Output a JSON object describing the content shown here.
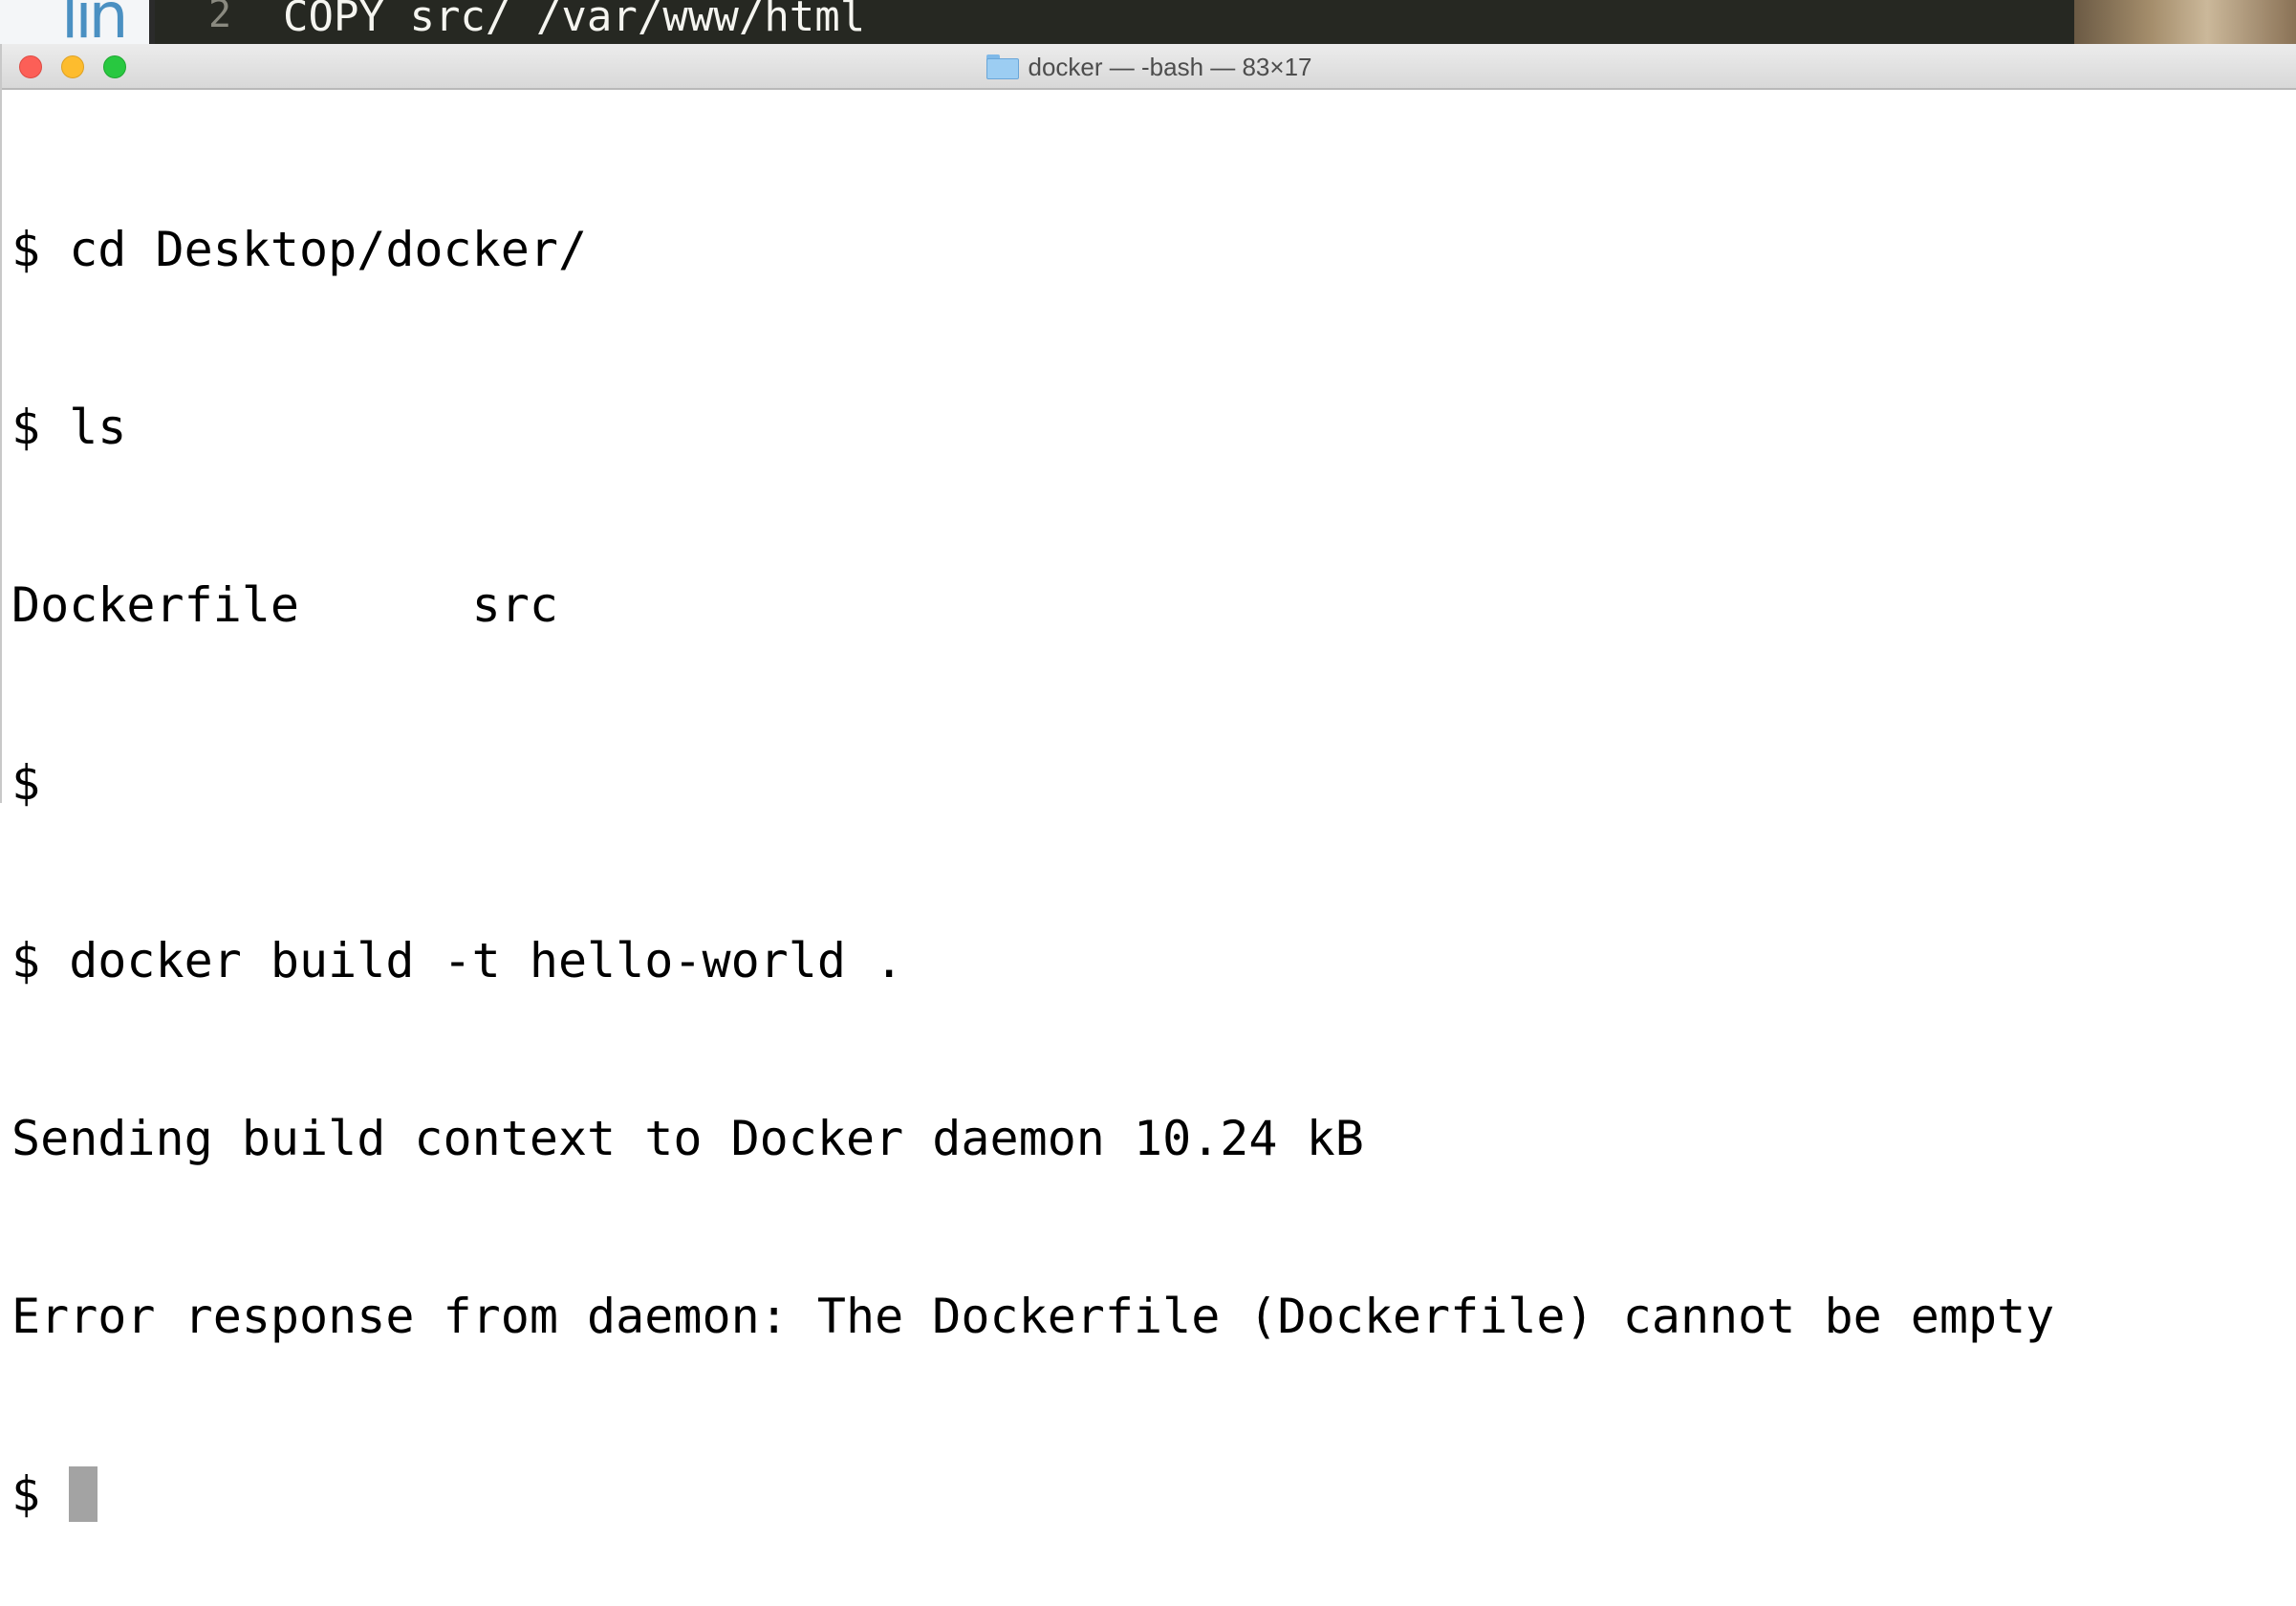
{
  "background_editor": {
    "logo_text": "lin",
    "line_number": "2",
    "line_text": "COPY src/ /var/www/html"
  },
  "window": {
    "title": "docker — -bash — 83×17",
    "title_icon": "folder-icon",
    "traffic_lights": [
      "close",
      "minimize",
      "zoom"
    ]
  },
  "terminal": {
    "lines": [
      "$ cd Desktop/docker/",
      "$ ls",
      "Dockerfile      src",
      "$",
      "$ docker build -t hello-world .",
      "Sending build context to Docker daemon 10.24 kB",
      "Error response from daemon: The Dockerfile (Dockerfile) cannot be empty"
    ],
    "prompt": "$ "
  },
  "colors": {
    "close": "#fc5f57",
    "minimize": "#fdbc2e",
    "zoom": "#28c840",
    "cursor": "#a3a3a3"
  }
}
